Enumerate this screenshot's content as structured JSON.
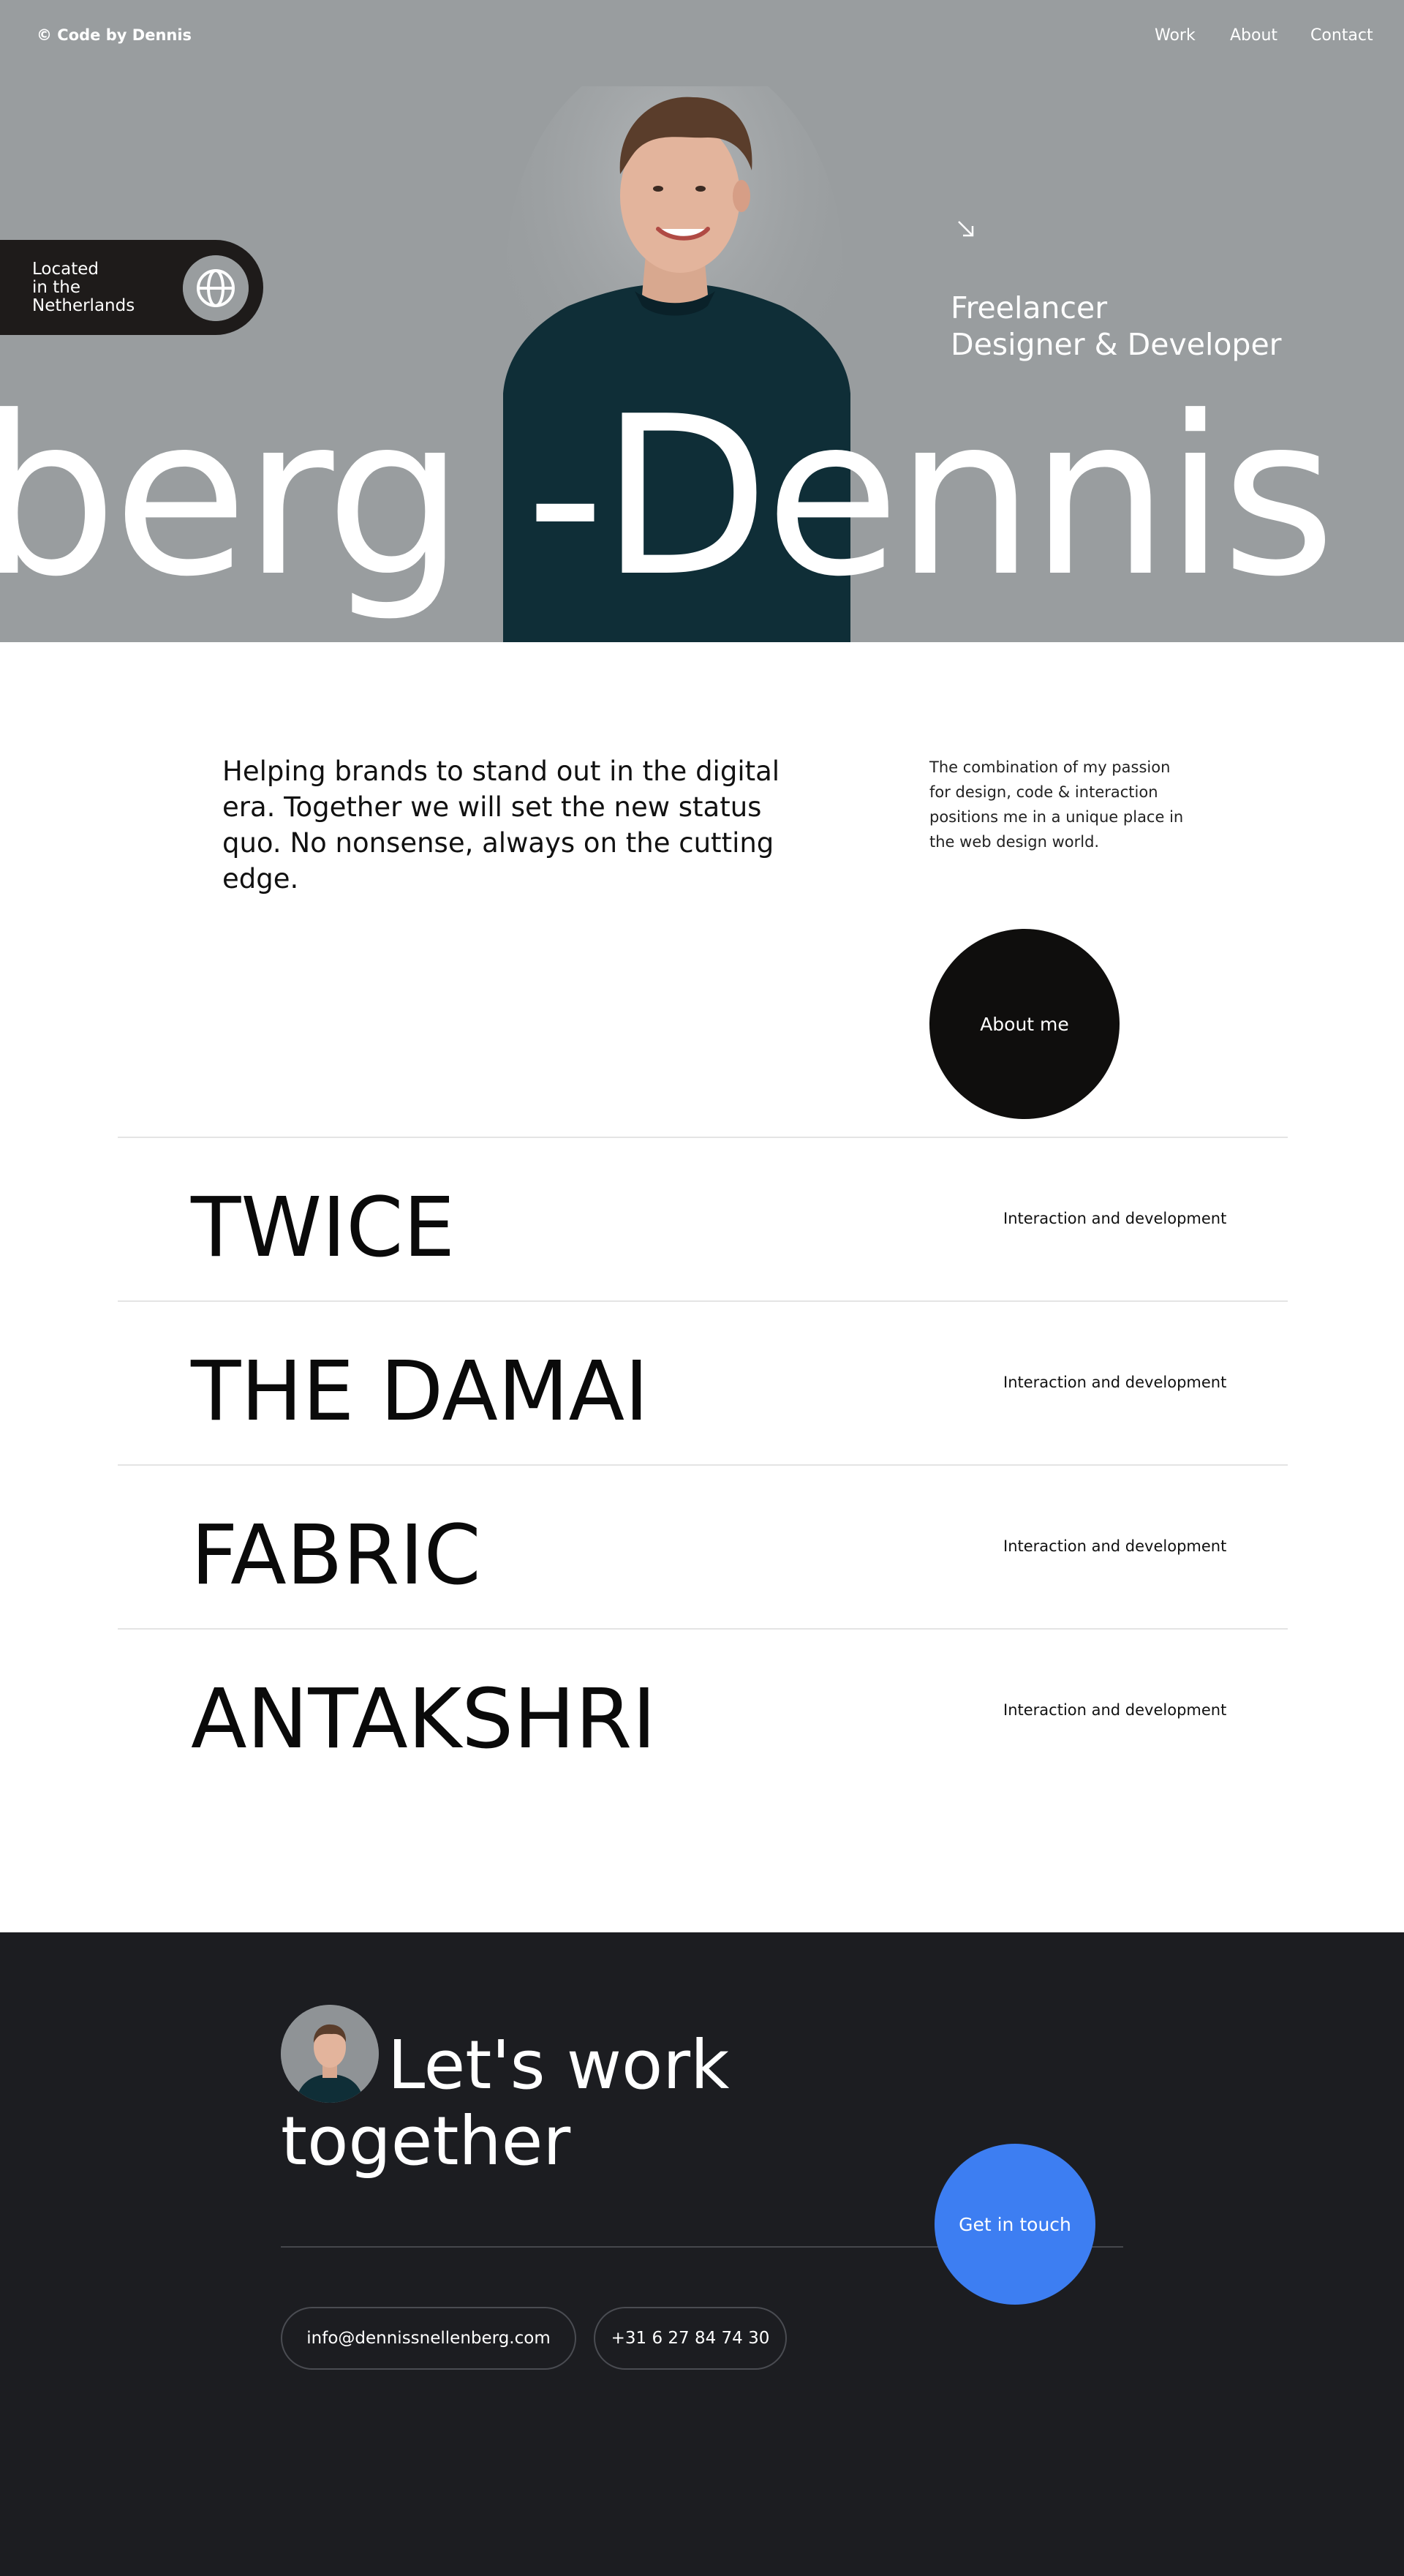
{
  "header": {
    "brand": "© Code by Dennis",
    "nav": [
      "Work",
      "About",
      "Contact"
    ]
  },
  "hero": {
    "location_lines": [
      "Located",
      "in the",
      "Netherlands"
    ],
    "tagline_lines": [
      "Freelancer",
      "Designer & Developer"
    ],
    "marquee": "berg -Dennis Sn",
    "arrow_icon": "arrow-down-right-icon",
    "globe_icon": "globe-icon",
    "background": "#999d9f"
  },
  "intro": {
    "headline": "Helping brands to stand out in the digital era. Together we will set the new status quo. No nonsense, always on the cutting edge.",
    "side": "The combination of my passion for design, code & interaction positions me in a unique place in the web design world.",
    "about_button": "About me"
  },
  "projects": [
    {
      "title": "TWICE",
      "meta": "Interaction and development"
    },
    {
      "title": "THE DAMAI",
      "meta": "Interaction and development"
    },
    {
      "title": "FABRIC",
      "meta": "Interaction and development"
    },
    {
      "title": "ANTAKSHRI",
      "meta": "Interaction and development"
    }
  ],
  "footer": {
    "title_line1": "Let's work",
    "title_line2": "together",
    "cta": "Get in touch",
    "email": "info@dennissnellenberg.com",
    "phone": "+31 6 27 84 74 30",
    "accent": "#3d7ef2",
    "background": "#1c1d21"
  }
}
